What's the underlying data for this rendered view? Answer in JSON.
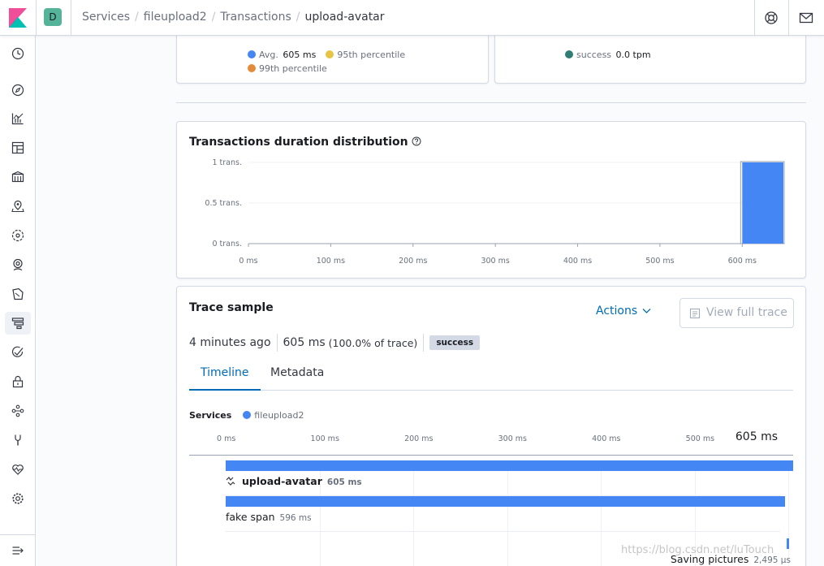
{
  "breadcrumbs": [
    "Services",
    "fileupload2",
    "Transactions",
    "upload-avatar"
  ],
  "space": {
    "initial": "D",
    "color": "#54b399"
  },
  "top_icons": [
    "help-icon",
    "mail-icon"
  ],
  "nav_items": [
    "clock-icon",
    "compass-icon",
    "visualize-icon",
    "dashboard-icon",
    "canvas-icon",
    "maps-icon",
    "ml-icon",
    "metrics-icon",
    "logs-icon",
    "apm-icon",
    "uptime-icon",
    "siem-icon",
    "graph-icon",
    "dev-tools-icon",
    "monitoring-icon",
    "management-icon"
  ],
  "nav_active_index": 9,
  "latency_legend": [
    {
      "label": "Avg.",
      "value": "605 ms",
      "color": "#4486f4"
    },
    {
      "label": "95th percentile",
      "value": "",
      "color": "#e7c444"
    },
    {
      "label": "99th percentile",
      "value": "",
      "color": "#e48a3b"
    }
  ],
  "tpm_legend": [
    {
      "label": "success",
      "value": "0.0 tpm",
      "color": "#2f7d73"
    }
  ],
  "distribution": {
    "title": "Transactions duration distribution",
    "help_icon": "question-circle-icon"
  },
  "chart_data": {
    "type": "bar",
    "title": "Transactions duration distribution",
    "xlabel": "",
    "ylabel": "",
    "x_ticks": [
      "0 ms",
      "100 ms",
      "200 ms",
      "300 ms",
      "400 ms",
      "500 ms",
      "600 ms"
    ],
    "y_ticks": [
      "0 trans.",
      "0.5 trans.",
      "1 trans."
    ],
    "xlim": [
      0,
      650
    ],
    "ylim": [
      0,
      1
    ],
    "bars": [
      {
        "x_start": 600,
        "x_end": 650,
        "value": 1
      }
    ],
    "bar_color": "#4486f4",
    "grid": true
  },
  "trace": {
    "title": "Trace sample",
    "actions_label": "Actions",
    "view_full_trace_label": "View full trace",
    "time_ago": "4 minutes ago",
    "duration": "605 ms",
    "duration_pct": "(100.0% of trace)",
    "result_badge": "success",
    "tabs": [
      "Timeline",
      "Metadata"
    ],
    "active_tab": 0,
    "services_label": "Services",
    "services": [
      {
        "name": "fileupload2",
        "color": "#4486f4"
      }
    ],
    "scale_ticks": [
      "0 ms",
      "100 ms",
      "200 ms",
      "300 ms",
      "400 ms",
      "500 ms"
    ],
    "scale_max": "605 ms",
    "total_ms": 605,
    "spans": [
      {
        "name": "upload-avatar",
        "duration": "605 ms",
        "start_ms": 0,
        "duration_ms": 605,
        "icon": "transaction-icon",
        "bold": true
      },
      {
        "name": "fake span",
        "duration": "596 ms",
        "start_ms": 0,
        "duration_ms": 596,
        "icon": "",
        "bold": false
      },
      {
        "name": "Saving pictures",
        "duration": "2,495 μs",
        "start_ms": 598,
        "duration_ms": 2.5,
        "icon": "",
        "bold": false
      }
    ]
  },
  "watermark": "https://blog.csdn.net/luTouch"
}
